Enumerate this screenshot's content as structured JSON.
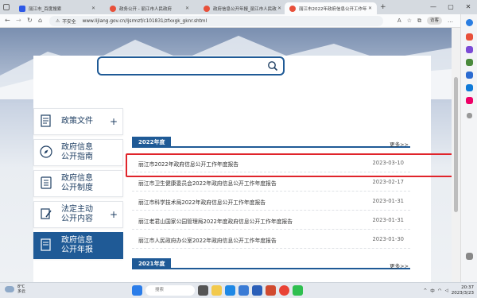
{
  "browser": {
    "tabs": [
      {
        "label": "丽江市_百度搜索",
        "favicon": "baidu",
        "active": false
      },
      {
        "label": "政务公开 - 丽江市人民政府",
        "favicon": "gov",
        "active": false
      },
      {
        "label": "政府信息公开年报_丽江市人民政",
        "favicon": "gov",
        "active": false
      },
      {
        "label": "丽江市2022年政府信息公开工作年",
        "favicon": "gov",
        "active": true
      }
    ],
    "new_tab_label": "+",
    "insecure_label": "不安全",
    "url": "www.lijiang.gov.cn/ljsrmzf/c101831/zfxxgk_gknr.shtml",
    "profile_label": "访客"
  },
  "search": {
    "placeholder": ""
  },
  "left_nav": [
    {
      "label_lines": [
        "政策文件"
      ],
      "icon": "document-icon",
      "plus": "+",
      "active": false
    },
    {
      "label_lines": [
        "政府信息",
        "公开指南"
      ],
      "icon": "compass-icon",
      "plus": "",
      "active": false
    },
    {
      "label_lines": [
        "政府信息",
        "公开制度"
      ],
      "icon": "list-doc-icon",
      "plus": "",
      "active": false
    },
    {
      "label_lines": [
        "法定主动",
        "公开内容"
      ],
      "icon": "pen-icon",
      "plus": "+",
      "active": false
    },
    {
      "label_lines": [
        "政府信息",
        "公开年报"
      ],
      "icon": "report-icon",
      "plus": "",
      "active": true
    }
  ],
  "sections": [
    {
      "year": "2022年度",
      "more": "更多>>",
      "items": [
        {
          "title": "丽江市2022年政府信息公开工作年度报告",
          "date": "2023-03-10"
        },
        {
          "title": "丽江市卫生健康委员会2022年政府信息公开工作年度报告",
          "date": "2023-02-17"
        },
        {
          "title": "丽江市科学技术局2022年政府信息公开工作年度报告",
          "date": "2023-01-31"
        },
        {
          "title": "丽江老君山国家公园管理局2022年度政府信息公开工作年度报告",
          "date": "2023-01-31"
        },
        {
          "title": "丽江市人民政府办公室2022年政府信息公开工作年度报告",
          "date": "2023-01-30"
        }
      ]
    },
    {
      "year": "2021年度",
      "more": "更多>>",
      "items": []
    }
  ],
  "taskbar": {
    "weather_temp": "8°C",
    "weather_desc": "多云",
    "search_placeholder": "搜索",
    "time": "20:37",
    "date": "2023/3/23",
    "lang": "中"
  },
  "colors": {
    "accent": "#1f5a96",
    "highlight": "#e0242b"
  }
}
